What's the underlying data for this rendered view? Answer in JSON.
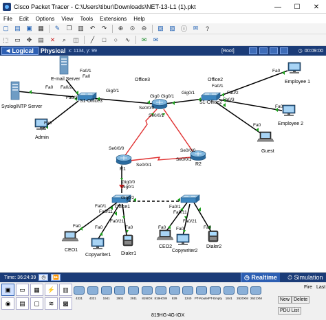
{
  "window": {
    "title": "Cisco Packet Tracer - C:\\Users\\tibur\\Downloads\\NET-13-L1 (1).pkt",
    "minimize": "—",
    "maximize": "☐",
    "close": "✕"
  },
  "menu": [
    "File",
    "Edit",
    "Options",
    "View",
    "Tools",
    "Extensions",
    "Help"
  ],
  "nav": {
    "logical": "Logical",
    "physical": "Physical",
    "coords": "x: 1134, y: 99",
    "root": "[Root]",
    "clock": "00:09:00"
  },
  "topology": {
    "area_labels": {
      "office3": "Office3",
      "office2": "Office2"
    },
    "devices": {
      "email_server": "E-mail Server",
      "syslog_server": "Syslog/NTP Server",
      "admin": "Admin",
      "s1_office3": "S1-Office3",
      "r_office3": "",
      "s1_office2": "S1-Office2",
      "employee1": "Employee 1",
      "employee2": "Employee 2",
      "guest": "Guest",
      "r1": "R1",
      "r2": "R2",
      "office1": "Office1",
      "ceo1": "CEO1",
      "copywriter1": "Copywriter1",
      "dialer1": "Dialer1",
      "ceo2": "CEO2",
      "copywriter2": "Copywriter2",
      "dialer2": "Dialer2"
    },
    "ports": {
      "email_fa01": "Fa0/1",
      "email_fa0": "Fa0",
      "syslog_fa0": "Fa0",
      "s3_fa02": "Fa0/2",
      "s3_fa03": "Fa0/3",
      "admin_fa0": "Fa0",
      "s3_gig01": "Gig0/1",
      "r3_gig0": "Gig0",
      "r3_gig01": "Gig0/1",
      "s2_gig01": "Gig0/1",
      "r3_se000": "Se0/0/0",
      "r3_se001": "Se0/0/1",
      "s2_fa01": "Fa0/1",
      "s2_fa02": "Fa0/2",
      "s2_fa03": "Fa0/3",
      "emp1_fa0": "Fa0",
      "emp2_fa0": "Fa0",
      "guest_fa0": "Fa0",
      "r1_se000": "Se0/0/0",
      "r1_se001": "Se0/0/1",
      "r2_se000": "Se0/0/0",
      "r2_se001": "Se0/0/1",
      "r1_gig00": "Gig0/0",
      "o1_gig01": "Gig0/1",
      "o1_gig02": "Gig0/2",
      "o1_fa01": "Fa0/1",
      "o1_fa011": "Fa0/11",
      "o1_fa021": "Fa0/21",
      "ceo1_fa0": "Fa0",
      "cw1_fa0": "Fa0",
      "dialer1_fa0": "Fa0",
      "s4_fa01": "Fa0/1",
      "s4_fa011": "Fa0/11",
      "s4_fa021": "Fa0/21",
      "ceo2_fa0": "Fa0",
      "cw2_fa0": "Fa0",
      "dialer2_fa0": "Fa0"
    }
  },
  "status": {
    "time": "Time: 36:24:39",
    "realtime": "Realtime",
    "simulation": "Simulation"
  },
  "palette": {
    "devices": [
      "4331",
      "4321",
      "1941",
      "2901",
      "2911",
      "819IOX",
      "819HGW",
      "829",
      "1240",
      "PT-Router",
      "PT-Empty",
      "1841",
      "2620XM",
      "2621XM"
    ],
    "selected_device": "819HG-4G-IOX",
    "fire": "Fire",
    "last_status": "Last",
    "new_btn": "New",
    "delete_btn": "Delete",
    "pdu_list": "PDU List"
  }
}
